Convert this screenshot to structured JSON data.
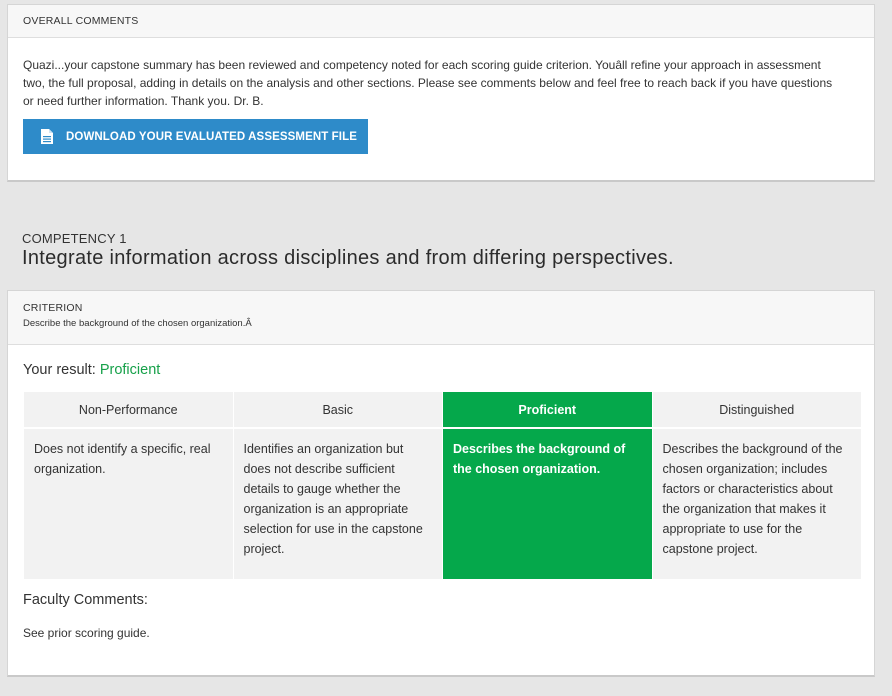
{
  "overall": {
    "heading": "OVERALL COMMENTS",
    "comment": "Quazi...your capstone summary has been reviewed and competency noted for each scoring guide criterion. Youâll refine your approach in assessment two, the full proposal, adding in details on the analysis and other sections. Please see comments below and feel free to reach back if you have questions or need further information. Thank you. Dr. B.",
    "download_label": "DOWNLOAD YOUR EVALUATED ASSESSMENT FILE",
    "download_icon": "document-icon",
    "accent_color": "#2e8bc9"
  },
  "competency": {
    "label": "COMPETENCY 1",
    "title": "Integrate information across disciplines and from differing perspectives."
  },
  "criterion": {
    "label": "CRITERION",
    "description": "Describe the background of the chosen organization.Â",
    "result_label": "Your result:",
    "result_value": "Proficient",
    "result_color": "#17a14a",
    "selected_color": "#05a84b",
    "levels": [
      {
        "name": "Non-Performance",
        "description": "Does not identify a specific, real organization.",
        "selected": false
      },
      {
        "name": "Basic",
        "description": "Identifies an organization but does not describe sufficient details to gauge whether the organization is an appropriate selection for use in the capstone project.",
        "selected": false
      },
      {
        "name": "Proficient",
        "description": "Describes the background of the chosen organization.",
        "selected": true
      },
      {
        "name": "Distinguished",
        "description": "Describes the background of the chosen organization; includes factors or characteristics about the organization that makes it appropriate to use for the capstone project.",
        "selected": false
      }
    ],
    "faculty_label": "Faculty Comments:",
    "faculty_comment": "See prior scoring guide."
  }
}
